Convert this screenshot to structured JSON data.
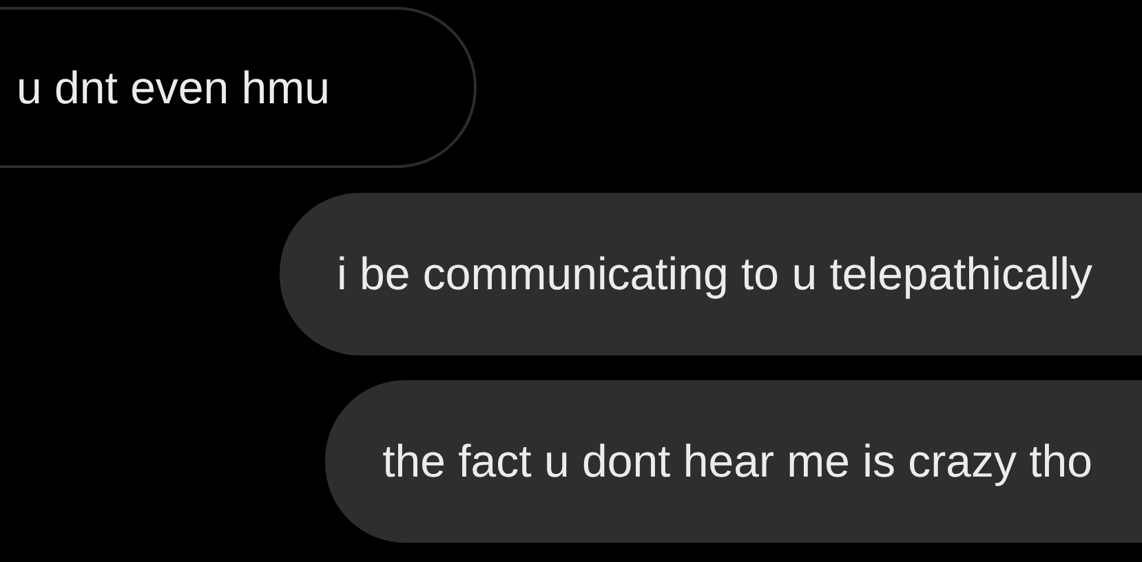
{
  "messages": [
    {
      "kind": "received",
      "text": "u dnt even hmu"
    },
    {
      "kind": "sent",
      "text": "i be communicating to u telepathically"
    },
    {
      "kind": "sent",
      "text": "the fact u dont hear me is crazy tho"
    }
  ]
}
